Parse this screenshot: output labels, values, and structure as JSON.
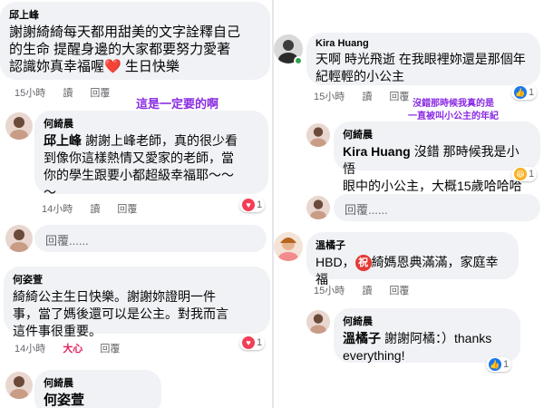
{
  "left": {
    "comment1": {
      "name": "邱上峰",
      "line1": "謝謝綺綺每天都用甜美的文字詮釋自己",
      "line2": "的生命 提醒身邊的大家都要努力愛著",
      "line3": "認識妳真幸福喔",
      "line3_suffix": "生日快樂",
      "heart_emoji": "❤️",
      "time": "15小時",
      "read": "讀",
      "reply": "回覆"
    },
    "annotation": "這是一定要的啊",
    "reply1": {
      "name": "何綺晨",
      "inline_name": "邱上峰",
      "line1": "謝謝上峰老師，真的很少看",
      "line2": "到像你這樣熱情又愛家的老師，當",
      "line3": "你的學生跟要小都超級幸福耶～～",
      "line4": "～",
      "time": "14小時",
      "read": "讀",
      "reply": "回覆",
      "reaction_count": "1"
    },
    "reply_input1": {
      "placeholder": "回覆......"
    },
    "comment2": {
      "name": "何姿萱",
      "line1": "綺綺公主生日快樂。謝謝妳證明一件",
      "line2": "事，當了媽後還可以是公主。對我而言",
      "line3": "這件事很重要。",
      "time": "14小時",
      "love": "大心",
      "reply": "回覆",
      "reaction_count": "1"
    },
    "reply2": {
      "name": "何綺晨",
      "inline_name": "何姿萱"
    }
  },
  "right": {
    "comment1": {
      "name": "Kira Huang",
      "line1": "天啊 時光飛逝 在我眼裡妳還是那個年",
      "line2": "紀輕輕的小公主",
      "time": "15小時",
      "read": "讀",
      "reply": "回覆",
      "reaction_count": "1"
    },
    "annotation_line1": "沒錯那時候我真的是",
    "annotation_line2": "一直被叫小公主的年紀",
    "reply1": {
      "name": "何綺晨",
      "inline_name": "Kira Huang",
      "line1": "沒錯 那時候我是小悟",
      "line2": "眼中的小公主，大概15歲哈哈哈",
      "reaction_count": "1"
    },
    "reply_input1": {
      "placeholder": "回覆......"
    },
    "comment2": {
      "name": "溫橘子",
      "line1_pre": "HBD，",
      "badge": "祝",
      "line1_post": "綺媽恩典滿滿，家庭幸福",
      "time": "15小時",
      "read": "讀",
      "reply": "回覆"
    },
    "reply2": {
      "name": "何綺晨",
      "inline_name": "溫橘子",
      "line1": "謝謝阿橘：）thanks",
      "line2": "everything!",
      "reaction_count": "1"
    }
  },
  "colors": {
    "bubble": "#f0f2f5",
    "meta_text": "#65676b",
    "annotation": "#8a2be2",
    "love_red": "#e0245e",
    "like_blue": "#1877f2"
  }
}
